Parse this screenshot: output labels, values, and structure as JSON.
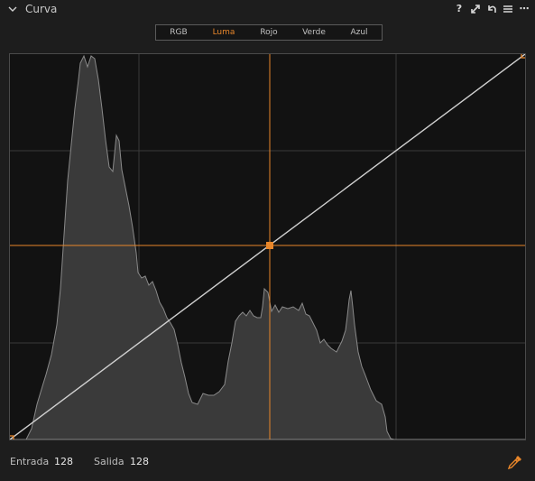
{
  "panel": {
    "title": "Curva"
  },
  "header_icons": [
    "help-icon",
    "expand-icon",
    "reset-icon",
    "menu-icon",
    "more-icon"
  ],
  "header_icon_glyphs": {
    "help": "?",
    "more": "⋯"
  },
  "tabs": [
    {
      "label": "RGB",
      "active": false
    },
    {
      "label": "Luma",
      "active": true
    },
    {
      "label": "Rojo",
      "active": false
    },
    {
      "label": "Verde",
      "active": false
    },
    {
      "label": "Azul",
      "active": false
    }
  ],
  "footer": {
    "input_label": "Entrada",
    "input_value": "128",
    "output_label": "Salida",
    "output_value": "128"
  },
  "curve": {
    "control_points": [
      [
        0,
        0
      ],
      [
        128,
        128
      ],
      [
        255,
        255
      ]
    ],
    "selected_point": [
      128,
      128
    ]
  },
  "colors": {
    "accent": "#e8862a",
    "background": "#1d1d1d",
    "plot_background": "#121212",
    "histogram_fill": "#3a3a3a",
    "histogram_stroke": "#8a8a8a",
    "curve": "#d0d0d0"
  }
}
